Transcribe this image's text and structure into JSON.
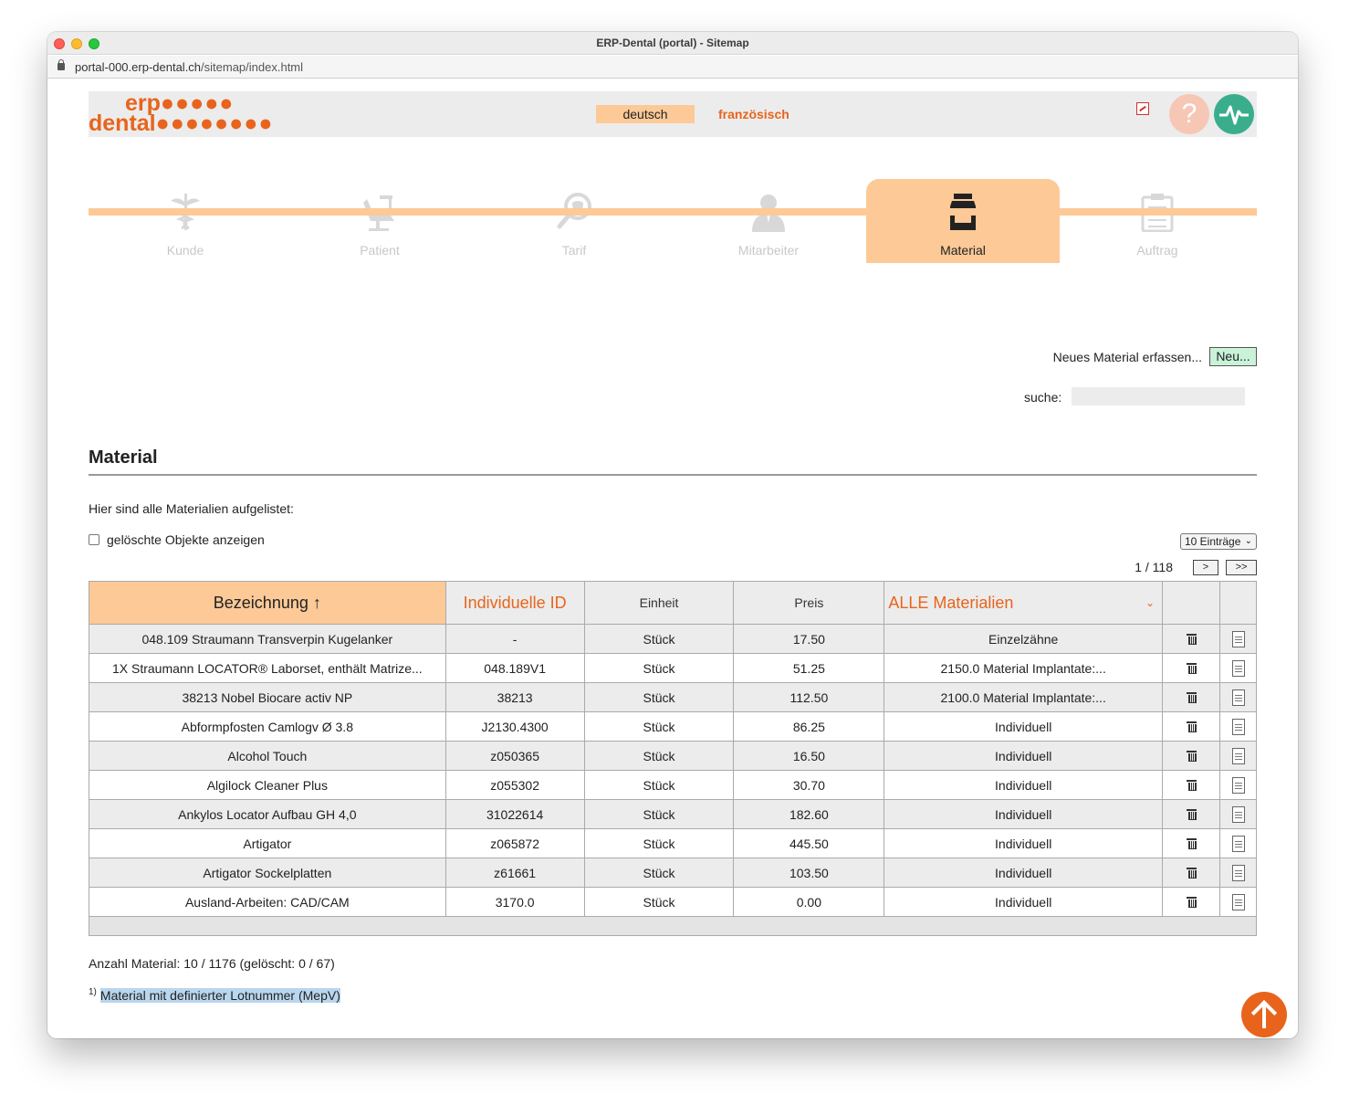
{
  "window": {
    "title": "ERP-Dental (portal) - Sitemap"
  },
  "address": {
    "host": "portal-000.erp-dental.ch",
    "path": "/sitemap/index.html"
  },
  "header": {
    "logo_line1": "erp",
    "logo_line2": "dental",
    "lang_de": "deutsch",
    "lang_fr": "französisch",
    "help_label": "?"
  },
  "tabs": [
    {
      "label": "Kunde",
      "icon": "caduceus-icon",
      "active": false
    },
    {
      "label": "Patient",
      "icon": "dental-chair-icon",
      "active": false
    },
    {
      "label": "Tarif",
      "icon": "magnifier-tooth-icon",
      "active": false
    },
    {
      "label": "Mitarbeiter",
      "icon": "person-icon",
      "active": false
    },
    {
      "label": "Material",
      "icon": "jar-icon",
      "active": true
    },
    {
      "label": "Auftrag",
      "icon": "clipboard-icon",
      "active": false
    }
  ],
  "actions": {
    "new_label": "Neues Material erfassen...",
    "new_button": "Neu...",
    "search_label": "suche:",
    "search_value": ""
  },
  "section": {
    "title": "Material",
    "intro": "Hier sind alle Materialien aufgelistet:",
    "show_deleted": "gelöschte Objekte anzeigen",
    "entries_select": "10 Einträge",
    "pager_label": "1 / 118",
    "pager_next": ">",
    "pager_last": ">>"
  },
  "table": {
    "headers": {
      "name": "Bezeichnung ↑",
      "id": "Individuelle ID",
      "unit": "Einheit",
      "price": "Preis",
      "group": "ALLE Materialien"
    },
    "rows": [
      {
        "name": "048.109 Straumann Transverpin Kugelanker",
        "id": "-",
        "unit": "Stück",
        "price": "17.50",
        "group": "Einzelzähne"
      },
      {
        "name": "1X Straumann LOCATOR® Laborset, enthält Matrize...",
        "id": "048.189V1",
        "unit": "Stück",
        "price": "51.25",
        "group": "2150.0 Material Implantate:..."
      },
      {
        "name": "38213 Nobel Biocare activ NP",
        "id": "38213",
        "unit": "Stück",
        "price": "112.50",
        "group": "2100.0 Material Implantate:..."
      },
      {
        "name": "Abformpfosten Camlogv Ø 3.8",
        "id": "J2130.4300",
        "unit": "Stück",
        "price": "86.25",
        "group": "Individuell"
      },
      {
        "name": "Alcohol Touch",
        "id": "z050365",
        "unit": "Stück",
        "price": "16.50",
        "group": "Individuell"
      },
      {
        "name": "Algilock Cleaner Plus",
        "id": "z055302",
        "unit": "Stück",
        "price": "30.70",
        "group": "Individuell"
      },
      {
        "name": "Ankylos Locator Aufbau GH 4,0",
        "id": "31022614",
        "unit": "Stück",
        "price": "182.60",
        "group": "Individuell"
      },
      {
        "name": "Artigator",
        "id": "z065872",
        "unit": "Stück",
        "price": "445.50",
        "group": "Individuell"
      },
      {
        "name": "Artigator Sockelplatten",
        "id": "z61661",
        "unit": "Stück",
        "price": "103.50",
        "group": "Individuell"
      },
      {
        "name": "Ausland-Arbeiten: CAD/CAM",
        "id": "3170.0",
        "unit": "Stück",
        "price": "0.00",
        "group": "Individuell"
      }
    ]
  },
  "footer": {
    "count": "Anzahl Material: 10 / 1176 (gelöscht: 0 / 67)",
    "footnote_mark": "1)",
    "footnote_text": "Material mit definierter Lotnummer (MepV)"
  },
  "colors": {
    "accent": "#e8641c",
    "tab_active": "#fcc997",
    "new_button": "#c9f2d9"
  }
}
